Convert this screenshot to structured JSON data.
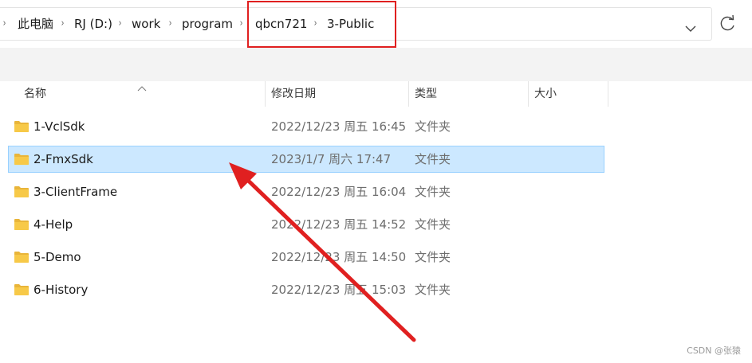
{
  "addressbar": {
    "breadcrumbs": [
      "此电脑",
      "RJ (D:)",
      "work",
      "program",
      "qbcn721",
      "3-Public"
    ],
    "separator": "›"
  },
  "columns": {
    "name": "名称",
    "modified": "修改日期",
    "type": "类型",
    "size": "大小"
  },
  "files": [
    {
      "name": "1-VclSdk",
      "modified": "2022/12/23 周五 16:45",
      "type": "文件夹",
      "selected": false
    },
    {
      "name": "2-FmxSdk",
      "modified": "2023/1/7 周六 17:47",
      "type": "文件夹",
      "selected": true
    },
    {
      "name": "3-ClientFrame",
      "modified": "2022/12/23 周五 16:04",
      "type": "文件夹",
      "selected": false
    },
    {
      "name": "4-Help",
      "modified": "2022/12/23 周五 14:52",
      "type": "文件夹",
      "selected": false
    },
    {
      "name": "5-Demo",
      "modified": "2022/12/23 周五 14:50",
      "type": "文件夹",
      "selected": false
    },
    {
      "name": "6-History",
      "modified": "2022/12/23 周五 15:03",
      "type": "文件夹",
      "selected": false
    }
  ],
  "icons": {
    "folder": "folder-icon",
    "dropdown": "chevron-down-icon",
    "refresh": "refresh-icon",
    "sort": "sort-caret-icon"
  },
  "colors": {
    "selection_bg": "#cce8ff",
    "selection_border": "#99d1ff",
    "annotation": "#e02020",
    "folder_yellow": "#f7c948"
  },
  "watermark": "CSDN @张猿"
}
